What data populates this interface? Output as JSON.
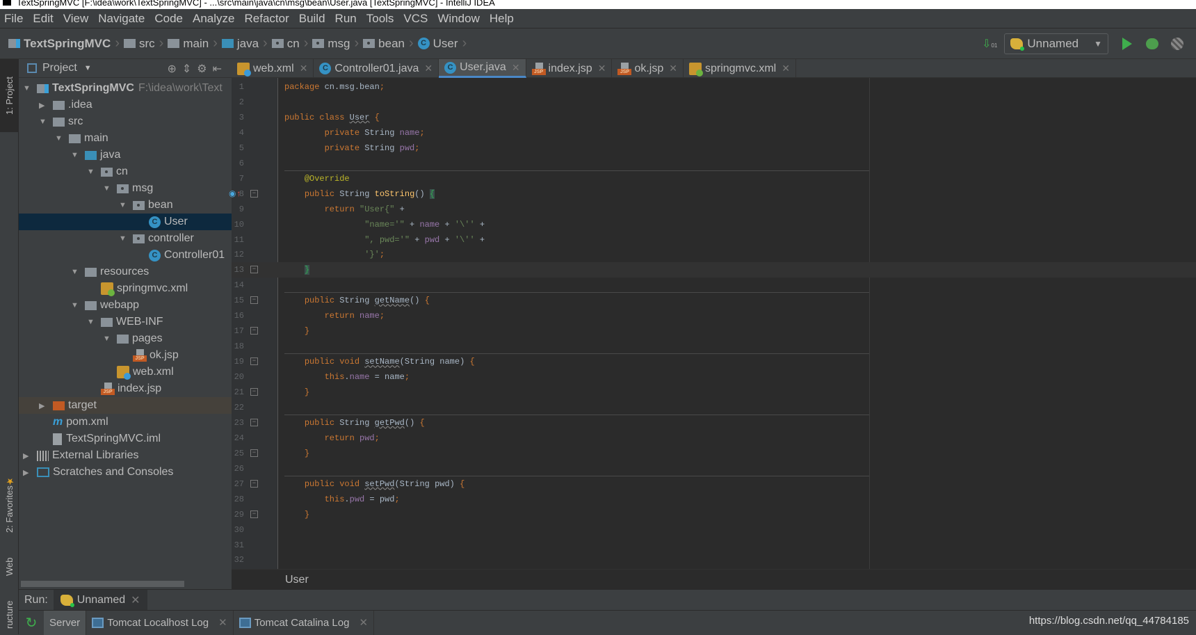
{
  "title": "TextSpringMVC [F:\\idea\\work\\TextSpringMVC] - ...\\src\\main\\java\\cn\\msg\\bean\\User.java [TextSpringMVC] - IntelliJ IDEA",
  "menu": [
    "File",
    "Edit",
    "View",
    "Navigate",
    "Code",
    "Analyze",
    "Refactor",
    "Build",
    "Run",
    "Tools",
    "VCS",
    "Window",
    "Help"
  ],
  "breadcrumb": [
    {
      "label": "TextSpringMVC",
      "icon": "module"
    },
    {
      "label": "src",
      "icon": "folder"
    },
    {
      "label": "main",
      "icon": "folder"
    },
    {
      "label": "java",
      "icon": "source-folder"
    },
    {
      "label": "cn",
      "icon": "package"
    },
    {
      "label": "msg",
      "icon": "package"
    },
    {
      "label": "bean",
      "icon": "package"
    },
    {
      "label": "User",
      "icon": "class"
    }
  ],
  "run_config": "Unnamed",
  "side_tabs": {
    "project": "1: Project",
    "favorites": "2: Favorites",
    "web": "Web",
    "structure": "ructure"
  },
  "project_panel": {
    "title": "Project"
  },
  "tree": [
    {
      "label": "TextSpringMVC",
      "hint": "F:\\idea\\work\\Text",
      "depth": 0,
      "arrow": "down",
      "icon": "module",
      "bold": true
    },
    {
      "label": ".idea",
      "depth": 1,
      "arrow": "right",
      "icon": "folder"
    },
    {
      "label": "src",
      "depth": 1,
      "arrow": "down",
      "icon": "folder"
    },
    {
      "label": "main",
      "depth": 2,
      "arrow": "down",
      "icon": "folder"
    },
    {
      "label": "java",
      "depth": 3,
      "arrow": "down",
      "icon": "source-folder"
    },
    {
      "label": "cn",
      "depth": 4,
      "arrow": "down",
      "icon": "package"
    },
    {
      "label": "msg",
      "depth": 5,
      "arrow": "down",
      "icon": "package"
    },
    {
      "label": "bean",
      "depth": 6,
      "arrow": "down",
      "icon": "package"
    },
    {
      "label": "User",
      "depth": 7,
      "arrow": "",
      "icon": "class",
      "selected": true
    },
    {
      "label": "controller",
      "depth": 6,
      "arrow": "down",
      "icon": "package"
    },
    {
      "label": "Controller01",
      "depth": 7,
      "arrow": "",
      "icon": "class"
    },
    {
      "label": "resources",
      "depth": 3,
      "arrow": "down",
      "icon": "resources-folder"
    },
    {
      "label": "springmvc.xml",
      "depth": 4,
      "arrow": "",
      "icon": "spring-xml"
    },
    {
      "label": "webapp",
      "depth": 3,
      "arrow": "down",
      "icon": "web-folder"
    },
    {
      "label": "WEB-INF",
      "depth": 4,
      "arrow": "down",
      "icon": "folder"
    },
    {
      "label": "pages",
      "depth": 5,
      "arrow": "down",
      "icon": "folder"
    },
    {
      "label": "ok.jsp",
      "depth": 6,
      "arrow": "",
      "icon": "jsp"
    },
    {
      "label": "web.xml",
      "depth": 5,
      "arrow": "",
      "icon": "web-xml"
    },
    {
      "label": "index.jsp",
      "depth": 4,
      "arrow": "",
      "icon": "jsp"
    },
    {
      "label": "target",
      "depth": 1,
      "arrow": "right",
      "icon": "excluded-folder",
      "excluded": true
    },
    {
      "label": "pom.xml",
      "depth": 1,
      "arrow": "",
      "icon": "maven"
    },
    {
      "label": "TextSpringMVC.iml",
      "depth": 1,
      "arrow": "",
      "icon": "iml"
    },
    {
      "label": "External Libraries",
      "depth": 0,
      "arrow": "right",
      "icon": "libraries"
    },
    {
      "label": "Scratches and Consoles",
      "depth": 0,
      "arrow": "right",
      "icon": "scratches"
    }
  ],
  "tabs": [
    {
      "label": "web.xml",
      "icon": "web-xml"
    },
    {
      "label": "Controller01.java",
      "icon": "class"
    },
    {
      "label": "User.java",
      "icon": "class",
      "active": true
    },
    {
      "label": "index.jsp",
      "icon": "jsp"
    },
    {
      "label": "ok.jsp",
      "icon": "jsp"
    },
    {
      "label": "springmvc.xml",
      "icon": "spring-xml"
    }
  ],
  "code": [
    [
      [
        "kw",
        "package "
      ],
      [
        "",
        "cn.msg.bean"
      ],
      [
        "kw",
        ";"
      ]
    ],
    [],
    [
      [
        "kw",
        "public class "
      ],
      [
        "sq",
        "User"
      ],
      [
        "",
        " "
      ],
      [
        "kw",
        "{"
      ]
    ],
    [
      [
        "",
        "        "
      ],
      [
        "kw",
        "private "
      ],
      [
        "",
        "String "
      ],
      [
        "fld",
        "name"
      ],
      [
        "kw",
        ";"
      ]
    ],
    [
      [
        "",
        "        "
      ],
      [
        "kw",
        "private "
      ],
      [
        "",
        "String "
      ],
      [
        "fld",
        "pwd"
      ],
      [
        "kw",
        ";"
      ]
    ],
    [],
    [
      [
        "",
        "    "
      ],
      [
        "ann",
        "@Override"
      ]
    ],
    [
      [
        "",
        "    "
      ],
      [
        "kw",
        "public "
      ],
      [
        "",
        "String "
      ],
      [
        "fn",
        "toString"
      ],
      [
        "",
        "() "
      ],
      [
        "brm",
        "{"
      ]
    ],
    [
      [
        "",
        "        "
      ],
      [
        "kw",
        "return "
      ],
      [
        "str",
        "\"User{\""
      ],
      [
        "",
        " +"
      ]
    ],
    [
      [
        "",
        "                "
      ],
      [
        "str",
        "\"name='\""
      ],
      [
        "",
        " + "
      ],
      [
        "fld",
        "name"
      ],
      [
        "",
        " + "
      ],
      [
        "str",
        "'\\''"
      ],
      [
        "",
        " +"
      ]
    ],
    [
      [
        "",
        "                "
      ],
      [
        "str",
        "\", pwd='\""
      ],
      [
        "",
        " + "
      ],
      [
        "fld",
        "pwd"
      ],
      [
        "",
        " + "
      ],
      [
        "str",
        "'\\''"
      ],
      [
        "",
        " +"
      ]
    ],
    [
      [
        "",
        "                "
      ],
      [
        "str",
        "'}'"
      ],
      [
        "kw",
        ";"
      ]
    ],
    [
      [
        "",
        "    "
      ],
      [
        "brm",
        "}"
      ]
    ],
    [],
    [
      [
        "",
        "    "
      ],
      [
        "kw",
        "public "
      ],
      [
        "",
        "String "
      ],
      [
        "sq",
        "getName"
      ],
      [
        "",
        "() "
      ],
      [
        "kw",
        "{"
      ]
    ],
    [
      [
        "",
        "        "
      ],
      [
        "kw",
        "return "
      ],
      [
        "fld",
        "name"
      ],
      [
        "kw",
        ";"
      ]
    ],
    [
      [
        "",
        "    "
      ],
      [
        "kw",
        "}"
      ]
    ],
    [],
    [
      [
        "",
        "    "
      ],
      [
        "kw",
        "public void "
      ],
      [
        "sq",
        "setName"
      ],
      [
        "",
        "(String name) "
      ],
      [
        "kw",
        "{"
      ]
    ],
    [
      [
        "",
        "        "
      ],
      [
        "kw",
        "this"
      ],
      [
        "",
        "."
      ],
      [
        "fld",
        "name"
      ],
      [
        "",
        " = name"
      ],
      [
        "kw",
        ";"
      ]
    ],
    [
      [
        "",
        "    "
      ],
      [
        "kw",
        "}"
      ]
    ],
    [],
    [
      [
        "",
        "    "
      ],
      [
        "kw",
        "public "
      ],
      [
        "",
        "String "
      ],
      [
        "sq",
        "getPwd"
      ],
      [
        "",
        "() "
      ],
      [
        "kw",
        "{"
      ]
    ],
    [
      [
        "",
        "        "
      ],
      [
        "kw",
        "return "
      ],
      [
        "fld",
        "pwd"
      ],
      [
        "kw",
        ";"
      ]
    ],
    [
      [
        "",
        "    "
      ],
      [
        "kw",
        "}"
      ]
    ],
    [],
    [
      [
        "",
        "    "
      ],
      [
        "kw",
        "public void "
      ],
      [
        "sq",
        "setPwd"
      ],
      [
        "",
        "(String pwd) "
      ],
      [
        "kw",
        "{"
      ]
    ],
    [
      [
        "",
        "        "
      ],
      [
        "kw",
        "this"
      ],
      [
        "",
        "."
      ],
      [
        "fld",
        "pwd"
      ],
      [
        "",
        " = pwd"
      ],
      [
        "kw",
        ";"
      ]
    ],
    [
      [
        "",
        "    "
      ],
      [
        "kw",
        "}"
      ]
    ],
    [],
    [],
    []
  ],
  "current_line": 13,
  "editor_breadcrumb": "User",
  "run": {
    "label": "Run:",
    "tab": "Unnamed"
  },
  "bottom_tabs": [
    "Server",
    "Tomcat Localhost Log",
    "Tomcat Catalina Log"
  ],
  "watermark": "https://blog.csdn.net/qq_44784185",
  "colors": {
    "background": "#2b2b2b",
    "keyword": "#cc7832",
    "string": "#6a8759",
    "field": "#9876aa",
    "annotation": "#bbb529",
    "method": "#ffc66d",
    "selection": "#0d293e"
  }
}
